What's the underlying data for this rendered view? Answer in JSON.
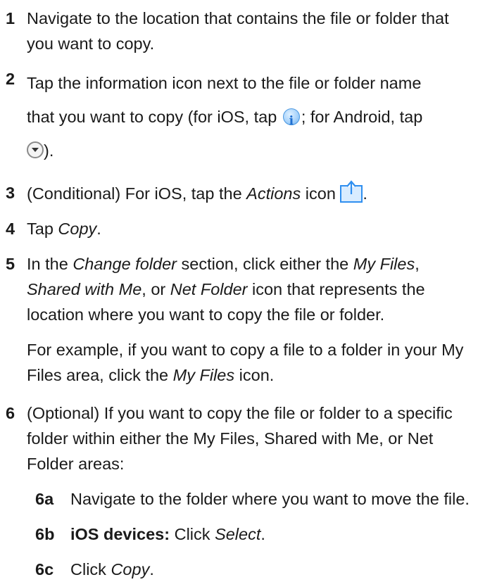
{
  "steps": [
    {
      "num": "1",
      "text": "Navigate to the location that contains the file or folder that you want to copy."
    },
    {
      "num": "2",
      "part1": "Tap the information icon next to the file or folder name",
      "part2": "that you want to copy (for iOS, tap",
      "part3": "; for Android, tap",
      "part4": ").",
      "ios_icon": "info-icon",
      "android_icon": "dropdown-circle-icon"
    },
    {
      "num": "3",
      "part1": "(Conditional) For iOS, tap the ",
      "actions": "Actions",
      "part2": " icon ",
      "part3": ".",
      "icon": "share-icon"
    },
    {
      "num": "4",
      "part1": "Tap ",
      "copy": "Copy",
      "part2": "."
    },
    {
      "num": "5",
      "part1": "In the ",
      "change_folder": "Change folder",
      "part2": " section, click either the ",
      "my_files": "My Files",
      "part3": ", ",
      "shared_with_me": "Shared with Me",
      "part4": ", or ",
      "net_folder": "Net Folder",
      "part5": " icon that represents the location where you want to copy the file or folder.",
      "example_part1": "For example, if you want to copy a file to a folder in your My Files area, click the ",
      "example_my_files": "My Files",
      "example_part2": " icon."
    },
    {
      "num": "6",
      "text": "(Optional) If you want to copy the file or folder to a specific folder within either the My Files, Shared with Me, or Net Folder areas:",
      "substeps": [
        {
          "num": "6a",
          "text": "Navigate to the folder where you want to move the file."
        },
        {
          "num": "6b",
          "bold": "iOS devices:",
          "part1": " Click ",
          "select": "Select",
          "part2": "."
        },
        {
          "num": "6c",
          "part1": "Click ",
          "copy": "Copy",
          "part2": "."
        }
      ]
    }
  ],
  "colors": {
    "text": "#1a1a1a",
    "info_icon_blue": "#4a97e0",
    "share_icon_blue": "#2f8ff0"
  }
}
